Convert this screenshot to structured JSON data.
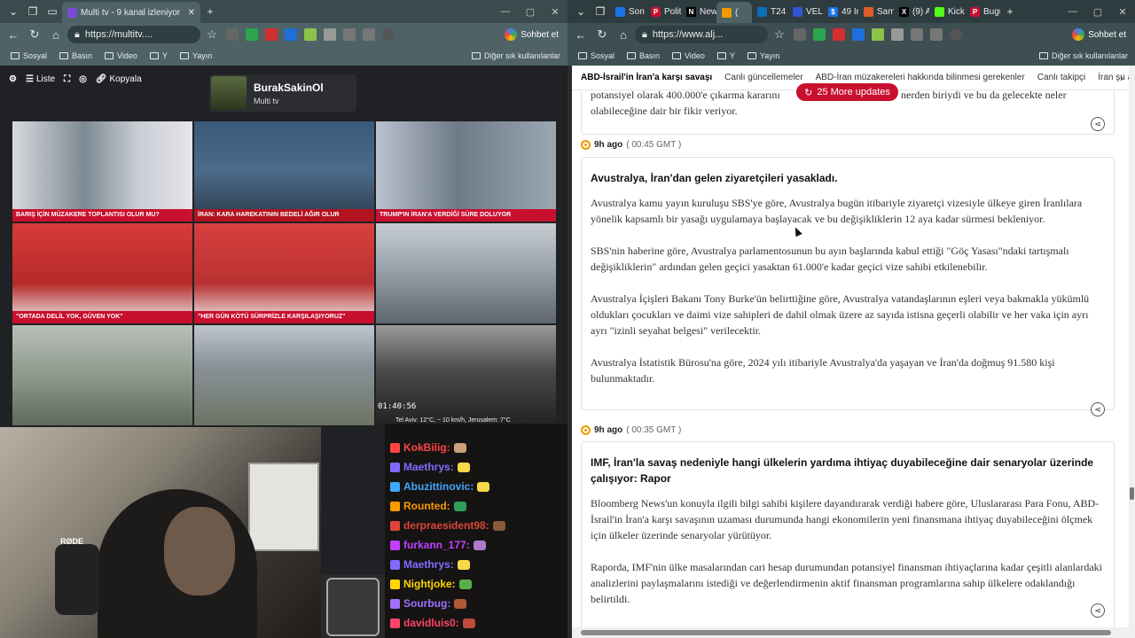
{
  "left_browser": {
    "tabs": [
      {
        "title": "Multi tv - 9 kanal izleniyor",
        "active": true
      }
    ],
    "address": "https://multitv....",
    "copilot_label": "Sohbet et",
    "bookmarks": [
      "Sosyal",
      "Basın",
      "Video",
      "Y",
      "Yayın"
    ],
    "other_bookmarks": "Diğer sık kullanılanlar"
  },
  "right_browser": {
    "tabs": [
      {
        "title": "Son",
        "favicon": "#1a73e8",
        "letter": ""
      },
      {
        "title": "Politi",
        "favicon": "#c8102e",
        "letter": "P"
      },
      {
        "title": "New",
        "favicon": "#000000",
        "letter": "N"
      },
      {
        "title": "(",
        "favicon": "#f29900",
        "letter": "",
        "active": true
      },
      {
        "title": "T24",
        "favicon": "#0b6fb8",
        "letter": ""
      },
      {
        "title": "VELO",
        "favicon": "#2f54d6",
        "letter": ""
      },
      {
        "title": "49 In",
        "favicon": "#1a73e8",
        "letter": "$"
      },
      {
        "title": "Sam",
        "favicon": "#e05a28",
        "letter": ""
      },
      {
        "title": "(9) A",
        "favicon": "#000000",
        "letter": "X"
      },
      {
        "title": "Kick",
        "favicon": "#53fc18",
        "letter": ""
      },
      {
        "title": "Bugü",
        "favicon": "#c8102e",
        "letter": "P"
      }
    ],
    "address": "https://www.alj...",
    "copilot_label": "Sohbet et",
    "bookmarks": [
      "Sosyal",
      "Basın",
      "Video",
      "Y",
      "Yayın"
    ],
    "other_bookmarks": "Diğer sık kullanılanlar"
  },
  "multitv": {
    "toolbar": {
      "list_label": "Liste",
      "copy_label": "Kopyala"
    },
    "channel": {
      "name": "BurakSakinOl",
      "subtitle": "Multi tv"
    },
    "tiles": [
      {
        "ticker": "BARIŞ İÇİN MÜZAKERE TOPLANTISI OLUR MU?",
        "ticker_bg": "#c8102e"
      },
      {
        "ticker": "İRAN: KARA HAREKATININ BEDELİ AĞIR OLUR",
        "ticker_bg": "#b3121f"
      },
      {
        "ticker": "TRUMP'IN İRAN'A VERDİĞİ SÜRE DOLUYOR",
        "ticker_bg": "#c8102e"
      },
      {
        "ticker": "\"ORTADA DELİL YOK, GÜVEN YOK\"",
        "ticker_bg": "#c8102e"
      },
      {
        "ticker": "\"HER GÜN KÖTÜ SÜRPRİZLE KARŞILAŞIYORUZ\"",
        "ticker_bg": "#c8102e"
      },
      {
        "ticker": "",
        "ticker_bg": ""
      },
      {
        "ticker": "",
        "ticker_bg": ""
      },
      {
        "ticker": "",
        "ticker_bg": ""
      },
      {
        "ticker": "",
        "ticker_bg": "",
        "time": "01:40:56",
        "weather": "Tel Aviv: 12°C, ~ 10 km/h, Jerusalem: 7°C"
      }
    ]
  },
  "chat": {
    "messages": [
      {
        "user": "KokBilig:",
        "color": "#ff4444"
      },
      {
        "user": "Maethrys:",
        "color": "#7f6cff"
      },
      {
        "user": "Abuzittinovic:",
        "color": "#40a8ff"
      },
      {
        "user": "Rounted:",
        "color": "#ff9900"
      },
      {
        "user": "derpraesident98:",
        "color": "#e0443a"
      },
      {
        "user": "furkann_177:",
        "color": "#c040ff"
      },
      {
        "user": "Maethrys:",
        "color": "#7f6cff"
      },
      {
        "user": "Nightjoke:",
        "color": "#ffd600"
      },
      {
        "user": "Sourbug:",
        "color": "#a070ff"
      },
      {
        "user": "davidluis0:",
        "color": "#ff4466"
      }
    ]
  },
  "live_blog": {
    "nav_tabs": [
      "ABD-İsrail'in İran'a karşı savaşı",
      "Canlı güncellemeler",
      "ABD-İran müzakereleri hakkında bilinmesi gerekenler",
      "Canlı takipçi",
      "İran şu anda dah"
    ],
    "more_updates": "25 More updates",
    "top_fragment_1": "potansiyel olarak 400.000'e çıkarma kararını",
    "top_fragment_2": "nerden biriydi ve bu da gelecekte neler",
    "top_fragment_3": "olabileceğine dair bir fikir veriyor.",
    "posts": [
      {
        "ago": "9h ago",
        "gmt": "( 00:45 GMT )",
        "title": "Avustralya, İran'dan gelen ziyaretçileri yasakladı.",
        "paragraphs": [
          "Avustralya kamu yayın kuruluşu SBS'ye göre, Avustralya bugün itibariyle ziyaretçi vizesiyle ülkeye giren İranlılara yönelik kapsamlı bir yasağı uygulamaya başlayacak ve bu değişikliklerin 12 aya kadar sürmesi bekleniyor.",
          "SBS'nin haberine göre, Avustralya parlamentosunun bu ayın başlarında kabul ettiği \"Göç Yasası\"ndaki tartışmalı değişikliklerin\" ardından gelen geçici yasaktan 61.000'e kadar geçici vize sahibi etkilenebilir.",
          "Avustralya İçişleri Bakanı Tony Burke'ün belirttiğine göre, Avustralya vatandaşlarının eşleri veya bakmakla yükümlü oldukları çocukları ve daimi vize sahipleri de dahil olmak üzere az sayıda istisna geçerli olabilir ve her vaka için ayrı ayrı \"izinli seyahat belgesi\" verilecektir.",
          "Avustralya İstatistik Bürosu'na göre, 2024 yılı itibariyle Avustralya'da yaşayan ve İran'da doğmuş 91.580 kişi bulunmaktadır."
        ]
      },
      {
        "ago": "9h ago",
        "gmt": "( 00:35 GMT )",
        "title": "IMF, İran'la savaş nedeniyle hangi ülkelerin yardıma ihtiyaç duyabileceğine dair senaryolar üzerinde çalışıyor: Rapor",
        "paragraphs": [
          "Bloomberg News'un konuyla ilgili bilgi sahibi kişilere dayandırarak verdiği habere göre, Uluslararası Para Fonu, ABD-İsrail'in İran'a karşı savaşının uzaması durumunda hangi ekonomilerin yeni finansmana ihtiyaç duyabileceğini ölçmek için ülkeler üzerinde senaryolar yürütüyor.",
          "Raporda, IMF'nin ülke masalarından cari hesap durumundan potansiyel finansman ihtiyaçlarına kadar çeşitli alanlardaki analizlerini paylaşmalarını istediği ve değerlendirmenin aktif finansman programlarına sahip ülkelere odaklandığı belirtildi."
        ]
      }
    ]
  }
}
